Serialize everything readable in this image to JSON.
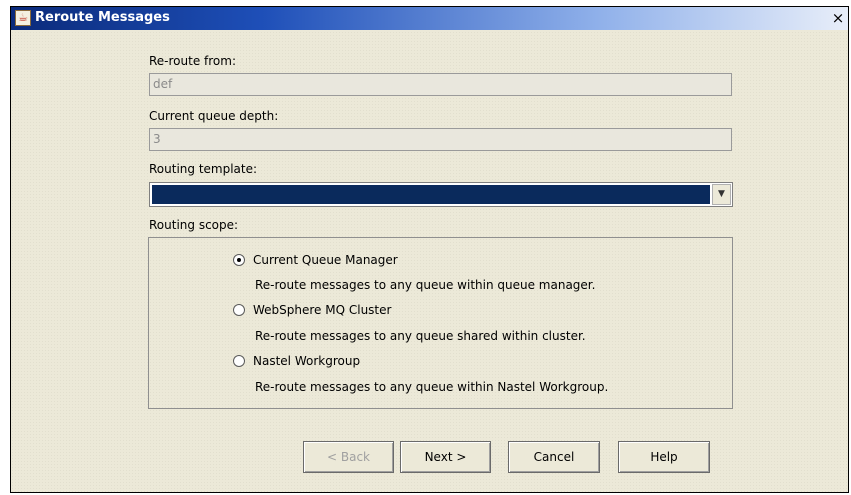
{
  "window": {
    "title": "Reroute Messages",
    "close_glyph": "×"
  },
  "form": {
    "reroute_from_label": "Re-route from:",
    "reroute_from_value": "def",
    "queue_depth_label": "Current queue depth:",
    "queue_depth_value": "3",
    "routing_template_label": "Routing template:",
    "routing_template_value": "",
    "routing_scope_label": "Routing scope:"
  },
  "scope_options": [
    {
      "label": "Current Queue Manager",
      "description": "Re-route messages to any queue within queue manager.",
      "checked": true
    },
    {
      "label": "WebSphere MQ Cluster",
      "description": "Re-route messages to any queue shared within cluster.",
      "checked": false
    },
    {
      "label": "Nastel Workgroup",
      "description": "Re-route messages to any queue within Nastel Workgroup.",
      "checked": false
    }
  ],
  "buttons": {
    "back": "< Back",
    "next": "Next >",
    "cancel": "Cancel",
    "help": "Help"
  },
  "colors": {
    "title_bar_start": "#0a2a7a",
    "combo_selection": "#0a2a5c",
    "dialog_background": "#ece9d8"
  }
}
